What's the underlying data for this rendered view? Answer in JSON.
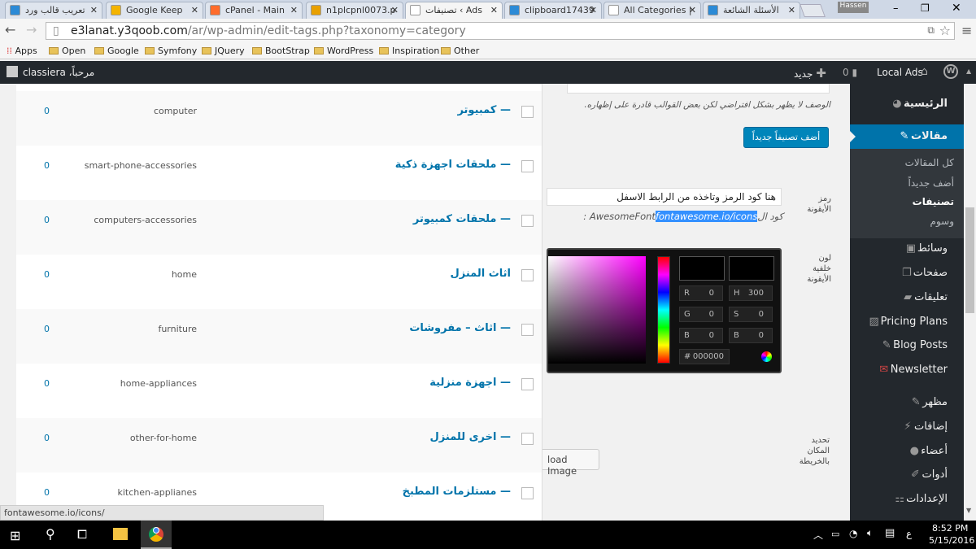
{
  "browser": {
    "tabs": [
      {
        "title": "تعريب قالب ورد",
        "color": "#2b8ad6"
      },
      {
        "title": "Google Keep",
        "color": "#f4b400"
      },
      {
        "title": "cPanel - Main",
        "color": "#ff6c2c"
      },
      {
        "title": "n1plcpnl0073.p",
        "color": "#e8a000"
      },
      {
        "title": "تصنيفات ‹ Ads",
        "color": "#ffffff",
        "active": true
      },
      {
        "title": "clipboard17439",
        "color": "#2b8ad6"
      },
      {
        "title": "All Categories |",
        "color": "#ffffff"
      },
      {
        "title": "الأسئلة الشائعة",
        "color": "#2b8ad6"
      }
    ],
    "profile": "Hassen",
    "url_host": "e3lanat.y3qoob.com",
    "url_path": "/ar/wp-admin/edit-tags.php?taxonomy=category",
    "bookmarks": [
      "Apps",
      "Open",
      "Google",
      "Symfony",
      "JQuery",
      "BootStrap",
      "WordPress",
      "Inspiration",
      "Other"
    ],
    "status_url": "fontawesome.io/icons/"
  },
  "adminbar": {
    "site": "Local Ads",
    "comments": "0",
    "new": "جديد",
    "greeting": "مرحباً، classiera"
  },
  "categories": [
    {
      "name": "— كمبيوتر",
      "slug": "computer",
      "count": "0"
    },
    {
      "name": "— ملحقات اجهزة ذكية",
      "slug": "smart-phone-accessories",
      "count": "0"
    },
    {
      "name": "— ملحقات كمبيوتر",
      "slug": "computers-accessories",
      "count": "0"
    },
    {
      "name": "اثاث المنزل",
      "slug": "home",
      "count": "0"
    },
    {
      "name": "— اثاث – مفروشات",
      "slug": "furniture",
      "count": "0"
    },
    {
      "name": "— اجهزة منزلية",
      "slug": "home-appliances",
      "count": "0"
    },
    {
      "name": "— اخرى للمنزل",
      "slug": "other-for-home",
      "count": "0"
    },
    {
      "name": "— مستلزمات المطبخ",
      "slug": "kitchen-applianes",
      "count": "0"
    }
  ],
  "form": {
    "description_hint": "الوصف لا يظهر بشكل افتراضي لكن بعض القوالب قادرة على إظهاره.",
    "add_button": "أضف تصنيفاً جديداً",
    "icon_label": "رمز الأيقونة",
    "icon_value": "هنا كود الرمز وتاخذه من الرابط الاسفل",
    "icon_hint_prefix": "كود ال",
    "icon_hint_link": "fontawesome.io/icons",
    "icon_hint_suffix": " : AwesomeFont",
    "color_label": "لون خلفية الأيقونة",
    "picker": {
      "R": "0",
      "G": "0",
      "B": "0",
      "H": "300",
      "S": "0",
      "Bv": "0",
      "hex": "000000"
    },
    "map_label": "تحديد المكان بالخريطة",
    "upload_button": "load Image"
  },
  "sidebar": {
    "items": [
      "الرئيسية",
      "مقالات",
      "وسائط",
      "صفحات",
      "تعليقات",
      "Pricing Plans",
      "Blog Posts",
      "Newsletter",
      "مظهر",
      "إضافات",
      "أعضاء",
      "أدوات",
      "الإعدادات"
    ],
    "sub": [
      "كل المقالات",
      "أضف جديداً",
      "تصنيفات",
      "وسوم"
    ],
    "accent": "#0073aa"
  },
  "taskbar": {
    "time": "8:52 PM",
    "date": "5/15/2016",
    "lang": "ع"
  }
}
